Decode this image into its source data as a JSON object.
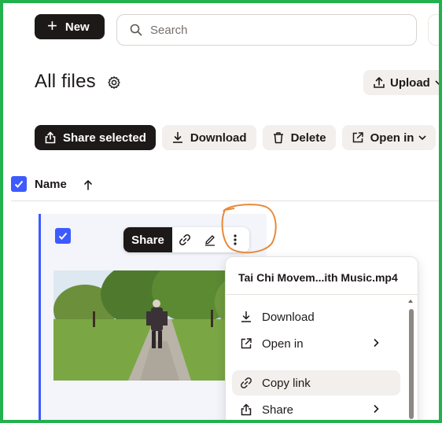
{
  "toolbar_top": {
    "new_label": "New",
    "search_placeholder": "Search"
  },
  "header": {
    "title": "All files",
    "upload_label": "Upload"
  },
  "actions": {
    "share_selected": "Share selected",
    "download": "Download",
    "delete": "Delete",
    "open_in": "Open in"
  },
  "list": {
    "name_column": "Name"
  },
  "file_card": {
    "share_label": "Share",
    "selected": true
  },
  "context_menu": {
    "file_name": "Tai Chi Movem...ith Music.mp4",
    "items": [
      {
        "label": "Download",
        "icon": "download-icon"
      },
      {
        "label": "Open in",
        "icon": "open-external-icon"
      },
      {
        "label": "Copy link",
        "icon": "link-icon"
      },
      {
        "label": "Share",
        "icon": "share-icon"
      }
    ]
  },
  "colors": {
    "accent": "#3d5aff",
    "dark": "#1e1919",
    "frame": "#22b14c",
    "annotation": "#e8893a"
  }
}
